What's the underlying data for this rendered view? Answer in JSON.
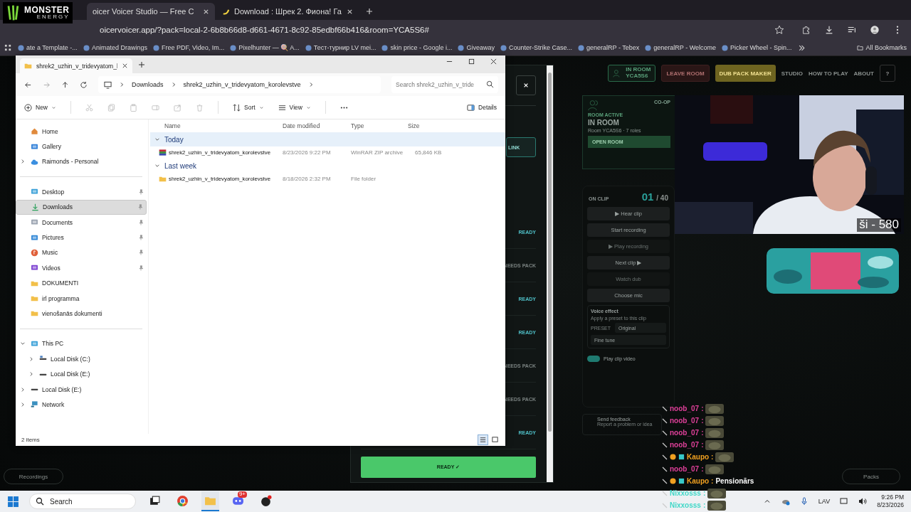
{
  "logo": {
    "line1": "MONSTER",
    "line2": "ENERGY"
  },
  "browser": {
    "tabs": [
      {
        "title": "oicer Voicer Studio — Free C",
        "selected": true
      },
      {
        "title": "Download : Шрек 2. Фиона! Га",
        "selected": false
      }
    ],
    "address": "oicervoicer.app/?pack=local-2-6b8b66d8-d661-4671-8c92-85edbf66b416&room=YCA5S6#",
    "bookmarks": [
      "ate a Template -...",
      "Animated Drawings",
      "Free PDF, Video, Im...",
      "Pixelhunter — 🍭 A...",
      "Тест-турнир LV mei...",
      "skin price - Google i...",
      "Giveaway",
      "Counter-Strike Case...",
      "generalRP - Tebex",
      "generalRP - Welcome",
      "Picker Wheel - Spin..."
    ],
    "all_bookmarks": "All Bookmarks"
  },
  "explorer": {
    "tab_title": "shrek2_uzhin_v_tridevyatom_l",
    "breadcrumb": [
      "Downloads",
      "shrek2_uzhin_v_tridevyatom_korolevstve"
    ],
    "search": {
      "placeholder": "Search shrek2_uzhin_v_tride"
    },
    "toolbar": {
      "new": "New",
      "sort": "Sort",
      "view": "View",
      "details": "Details"
    },
    "columns": [
      "Name",
      "Date modified",
      "Type",
      "Size"
    ],
    "groups": [
      {
        "label": "Today",
        "expanded": true,
        "selected": true,
        "items": [
          {
            "kind": "archive",
            "name": "shrek2_uzhin_v_tridevyatom_korolevstve",
            "date": "8/23/2026 9:22 PM",
            "type": "WinRAR ZIP archive",
            "size": "65,846 KB"
          }
        ]
      },
      {
        "label": "Last week",
        "expanded": true,
        "selected": false,
        "items": [
          {
            "kind": "folder",
            "name": "shrek2_uzhin_v_tridevyatom_korolevstve",
            "date": "8/18/2026 2:32 PM",
            "type": "File folder"
          }
        ]
      }
    ],
    "nav": [
      [
        {
          "label": "Home",
          "kind": "home",
          "pinned": false,
          "selected": false
        },
        {
          "label": "Gallery",
          "kind": "gallery",
          "pinned": false,
          "selected": false
        },
        {
          "label": "Raimonds - Personal",
          "kind": "cloud",
          "pinned": false,
          "selected": false,
          "expanded": false
        }
      ],
      [
        {
          "label": "Desktop",
          "kind": "desktop",
          "pinned": true,
          "selected": false
        },
        {
          "label": "Downloads",
          "kind": "download",
          "pinned": true,
          "selected": true
        },
        {
          "label": "Documents",
          "kind": "document",
          "pinned": true,
          "selected": false
        },
        {
          "label": "Pictures",
          "kind": "pictures",
          "pinned": true,
          "selected": false
        },
        {
          "label": "Music",
          "kind": "music",
          "pinned": true,
          "selected": false
        },
        {
          "label": "Videos",
          "kind": "video",
          "pinned": true,
          "selected": false
        },
        {
          "label": "DOKUMENTI",
          "kind": "folder",
          "pinned": false,
          "selected": false
        },
        {
          "label": "irl programma",
          "kind": "folder",
          "pinned": false,
          "selected": false
        },
        {
          "label": "vienošanās dokumenti",
          "kind": "folder",
          "pinned": false,
          "selected": false
        }
      ],
      [
        {
          "label": "This PC",
          "kind": "pc",
          "pinned": false,
          "selected": false,
          "expanded": true,
          "children": [
            {
              "label": "Local Disk (C:)",
              "kind": "system-disk",
              "pinned": false,
              "selected": false,
              "expanded": false
            },
            {
              "label": "Local Disk (E:)",
              "kind": "disk",
              "pinned": false,
              "selected": false,
              "expanded": false
            }
          ]
        },
        {
          "label": "Local Disk (E:)",
          "kind": "disk",
          "pinned": false,
          "selected": false,
          "expanded": false
        },
        {
          "label": "Network",
          "kind": "network",
          "pinned": false,
          "selected": false,
          "expanded": false
        }
      ]
    ],
    "status": "2 items",
    "view_buttons": [
      {
        "kind": "details",
        "selected": true
      },
      {
        "kind": "tiles",
        "selected": false
      }
    ]
  },
  "app": {
    "nav": [
      {
        "kind": "room",
        "label": "IN ROOM",
        "sub": "YCA5S6"
      },
      {
        "kind": "leave",
        "label": "LEAVE ROOM"
      },
      {
        "kind": "primary",
        "label": "DUB PACK MAKER"
      },
      {
        "kind": "link",
        "label": "STUDIO"
      },
      {
        "kind": "link",
        "label": "HOW TO PLAY"
      },
      {
        "kind": "link",
        "label": "ABOUT"
      },
      {
        "kind": "help",
        "label": "?"
      }
    ],
    "room_card": {
      "badge": "CO-OP",
      "eyebrow": "ROOM ACTIVE",
      "title": "IN ROOM",
      "subtitle": "Room YCA5S6 · 7 roles",
      "button": "OPEN ROOM"
    },
    "clip": {
      "label": "ON CLIP",
      "current": "01",
      "total": "/ 40",
      "buttons": [
        {
          "label": "▶ Hear clip",
          "disabled": false
        },
        {
          "label": "Start recording",
          "disabled": false
        },
        {
          "label": "▶ Play recording",
          "disabled": true
        },
        {
          "label": "Next clip ▶",
          "disabled": false
        },
        {
          "label": "Watch dub",
          "disabled": true
        },
        {
          "label": "Choose mic",
          "disabled": false
        }
      ],
      "voice_effect": {
        "title": "Voice effect",
        "hint": "Apply a preset to this clip",
        "preset_label": "PRESET",
        "preset": "Original",
        "fine_tune": "Fine tune"
      },
      "video_toggle": {
        "label": "Play clip video",
        "on": true
      }
    },
    "feedback": {
      "title": "Send feedback",
      "hint": "Report a problem or idea"
    },
    "recordings": "Recordings",
    "packs": "Packs",
    "panel": {
      "link": "LINK",
      "roles": [
        {
          "status": "READY",
          "kind": "ready"
        },
        {
          "status": "NEEDS PACK",
          "kind": "needs"
        },
        {
          "status": "READY",
          "kind": "ready"
        },
        {
          "status": "READY",
          "kind": "ready"
        },
        {
          "status": "NEEDS PACK",
          "kind": "needs"
        },
        {
          "status": "NEEDS PACK",
          "kind": "needs"
        },
        {
          "status": "READY",
          "kind": "ready"
        }
      ],
      "ready_button": "READY ✓"
    }
  },
  "webcam": {
    "kind": "picture",
    "caption": "ši - 580"
  },
  "chat": [
    {
      "user": "noob_07",
      "sep": ":",
      "color": "#e0409a",
      "kind": "emote"
    },
    {
      "user": "noob_07",
      "sep": ":",
      "color": "#e0409a",
      "kind": "emote"
    },
    {
      "user": "noob_07",
      "sep": ":",
      "color": "#e0409a",
      "kind": "emote"
    },
    {
      "user": "noob_07",
      "sep": ":",
      "color": "#e0409a",
      "kind": "emote"
    },
    {
      "user": "Kaupo",
      "sep": ":",
      "color": "#f0a020",
      "kind": "emote-badges"
    },
    {
      "user": "noob_07",
      "sep": ":",
      "color": "#e0409a",
      "kind": "emote"
    },
    {
      "user": "Kaupo",
      "sep": ":",
      "color": "#f0a020",
      "kind": "text-badges",
      "text": "Pensionārs"
    },
    {
      "user": "Nixxosss",
      "sep": ":",
      "color": "#40d8c8",
      "kind": "emote"
    },
    {
      "user": "Nixxosss",
      "sep": ":",
      "color": "#40d8c8",
      "kind": "emote"
    }
  ],
  "taskbar": {
    "search": "Search",
    "apps": [
      {
        "kind": "taskview",
        "active": false
      },
      {
        "kind": "chrome",
        "active": false
      },
      {
        "kind": "files",
        "active": true
      },
      {
        "kind": "discord",
        "active": false,
        "badge": "9+"
      },
      {
        "kind": "dark",
        "active": false
      }
    ],
    "lang": "LAV",
    "time": "9:26 PM",
    "date": "8/23/2026"
  }
}
